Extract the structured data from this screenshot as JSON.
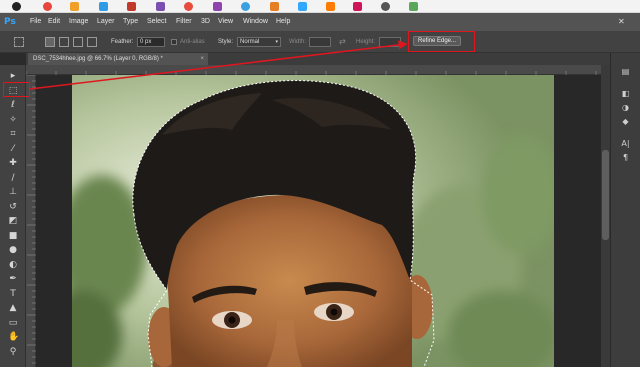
{
  "app": {
    "logo": "Ps"
  },
  "menu": [
    "File",
    "Edit",
    "Image",
    "Layer",
    "Type",
    "Select",
    "Filter",
    "3D",
    "View",
    "Window",
    "Help"
  ],
  "options_bar": {
    "feather_label": "Feather:",
    "feather_value": "0 px",
    "antialias_label": "Anti-alias",
    "style_label": "Style:",
    "style_value": "Normal",
    "width_label": "Width:",
    "height_label": "Height:",
    "refine_edge_label": "Refine Edge..."
  },
  "document": {
    "tab_title": "DSC_7534hhee.jpg @ 66.7% (Layer 0, RGB/8) *"
  },
  "tools": [
    {
      "name": "move-tool-icon",
      "glyph": "▸"
    },
    {
      "name": "rectangular-marquee-tool-icon",
      "glyph": "⬚"
    },
    {
      "name": "lasso-tool-icon",
      "glyph": "ℓ"
    },
    {
      "name": "magic-wand-tool-icon",
      "glyph": "✧"
    },
    {
      "name": "crop-tool-icon",
      "glyph": "⌗"
    },
    {
      "name": "eyedropper-tool-icon",
      "glyph": "⁄"
    },
    {
      "name": "healing-brush-tool-icon",
      "glyph": "✚"
    },
    {
      "name": "brush-tool-icon",
      "glyph": "∕"
    },
    {
      "name": "clone-stamp-tool-icon",
      "glyph": "⊥"
    },
    {
      "name": "history-brush-tool-icon",
      "glyph": "↺"
    },
    {
      "name": "eraser-tool-icon",
      "glyph": "◩"
    },
    {
      "name": "gradient-tool-icon",
      "glyph": "■"
    },
    {
      "name": "blur-tool-icon",
      "glyph": "●"
    },
    {
      "name": "dodge-tool-icon",
      "glyph": "◐"
    },
    {
      "name": "pen-tool-icon",
      "glyph": "✒"
    },
    {
      "name": "type-tool-icon",
      "glyph": "T"
    },
    {
      "name": "path-selection-tool-icon",
      "glyph": "▲"
    },
    {
      "name": "rectangle-tool-icon",
      "glyph": "▭"
    },
    {
      "name": "hand-tool-icon",
      "glyph": "✋"
    },
    {
      "name": "zoom-tool-icon",
      "glyph": "⚲"
    }
  ],
  "panels": [
    {
      "name": "history-panel-icon",
      "glyph": "▤"
    },
    {
      "name": "layers-panel-icon",
      "glyph": "◧"
    },
    {
      "name": "adjustments-panel-icon",
      "glyph": "◑"
    },
    {
      "name": "color-panel-icon",
      "glyph": "◆"
    },
    {
      "name": "character-panel-icon",
      "glyph": "A|"
    },
    {
      "name": "paragraph-panel-icon",
      "glyph": "¶"
    }
  ],
  "colors": {
    "highlight": "#e0161f",
    "accent": "#31a8ff"
  }
}
